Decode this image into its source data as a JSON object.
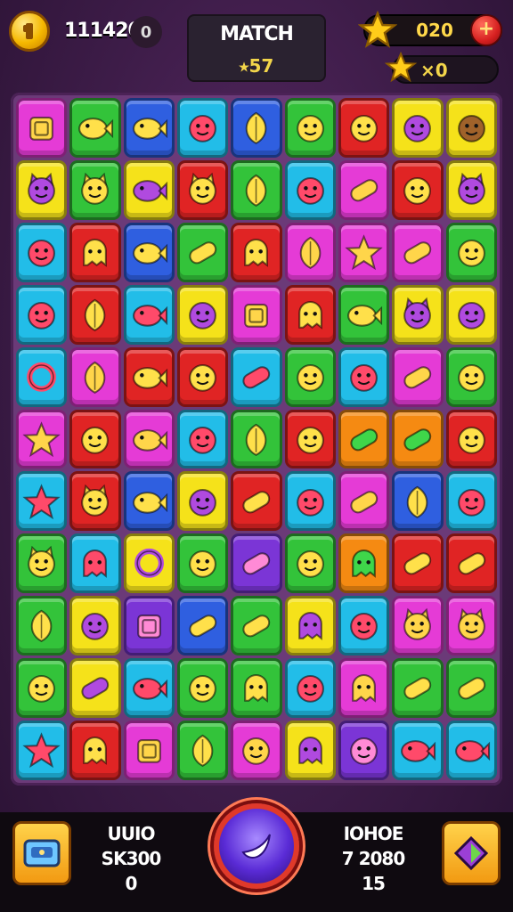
{
  "hud": {
    "coins": "111420",
    "coin_pill": "0",
    "match_title": "MATCH",
    "match_moves": "⭑57",
    "stars": "020",
    "plus": "+",
    "star_count": "×0"
  },
  "bottom": {
    "left_lines": [
      "UUIO",
      "SK300",
      "0"
    ],
    "right_lines": [
      "IOHOE",
      "7 2080",
      "15"
    ]
  },
  "colors": {
    "magenta": "#e53bd6",
    "green": "#33c33a",
    "blue": "#2f5fe0",
    "cyan": "#22bde8",
    "red": "#e02424",
    "yellow": "#f5e21a",
    "purple": "#7b35d6",
    "orange": "#f58a12"
  },
  "tiles": [
    [
      "magenta",
      "cup-icon"
    ],
    [
      "green",
      "fish-face-icon"
    ],
    [
      "blue",
      "fish-face-icon"
    ],
    [
      "cyan",
      "smiley-face-icon"
    ],
    [
      "blue",
      "leaf-icon"
    ],
    [
      "green",
      "smiley-face-icon"
    ],
    [
      "red",
      "smiley-face-icon"
    ],
    [
      "yellow",
      "smiley-face-icon"
    ],
    [
      "yellow",
      "cookie-face-icon"
    ],
    [
      "yellow",
      "cat-face-icon"
    ],
    [
      "green",
      "cat-face-icon"
    ],
    [
      "yellow",
      "fish-face-icon"
    ],
    [
      "red",
      "cat-face-icon"
    ],
    [
      "green",
      "leaf-icon"
    ],
    [
      "cyan",
      "smiley-face-icon"
    ],
    [
      "magenta",
      "bean-icon"
    ],
    [
      "red",
      "smiley-face-icon"
    ],
    [
      "yellow",
      "cat-face-icon"
    ],
    [
      "cyan",
      "smiley-face-icon"
    ],
    [
      "red",
      "ghost-icon"
    ],
    [
      "blue",
      "fish-face-icon"
    ],
    [
      "green",
      "bean-icon"
    ],
    [
      "red",
      "ghost-icon"
    ],
    [
      "magenta",
      "leaf-icon"
    ],
    [
      "magenta",
      "star-icon"
    ],
    [
      "magenta",
      "bean-icon"
    ],
    [
      "green",
      "smiley-face-icon"
    ],
    [
      "cyan",
      "smiley-face-icon"
    ],
    [
      "red",
      "leaf-icon"
    ],
    [
      "cyan",
      "fish-face-icon"
    ],
    [
      "yellow",
      "smiley-face-icon"
    ],
    [
      "magenta",
      "cup-icon"
    ],
    [
      "red",
      "ghost-icon"
    ],
    [
      "green",
      "fish-face-icon"
    ],
    [
      "yellow",
      "cat-face-icon"
    ],
    [
      "yellow",
      "smiley-face-icon"
    ],
    [
      "cyan",
      "ring-icon"
    ],
    [
      "magenta",
      "leaf-icon"
    ],
    [
      "red",
      "fish-face-icon"
    ],
    [
      "red",
      "smiley-face-icon"
    ],
    [
      "cyan",
      "bean-icon"
    ],
    [
      "green",
      "smiley-face-icon"
    ],
    [
      "cyan",
      "smiley-face-icon"
    ],
    [
      "magenta",
      "bean-icon"
    ],
    [
      "green",
      "smiley-face-icon"
    ],
    [
      "magenta",
      "star-icon"
    ],
    [
      "red",
      "smiley-face-icon"
    ],
    [
      "magenta",
      "fish-face-icon"
    ],
    [
      "cyan",
      "smiley-face-icon"
    ],
    [
      "green",
      "leaf-icon"
    ],
    [
      "red",
      "smiley-face-icon"
    ],
    [
      "orange",
      "bean-icon"
    ],
    [
      "orange",
      "bean-icon"
    ],
    [
      "red",
      "smiley-face-icon"
    ],
    [
      "cyan",
      "star-icon"
    ],
    [
      "red",
      "cat-face-icon"
    ],
    [
      "blue",
      "fish-face-icon"
    ],
    [
      "yellow",
      "smiley-face-icon"
    ],
    [
      "red",
      "bean-icon"
    ],
    [
      "cyan",
      "smiley-face-icon"
    ],
    [
      "magenta",
      "bean-icon"
    ],
    [
      "blue",
      "leaf-icon"
    ],
    [
      "cyan",
      "smiley-face-icon"
    ],
    [
      "green",
      "cat-face-icon"
    ],
    [
      "cyan",
      "ghost-icon"
    ],
    [
      "yellow",
      "ring-icon"
    ],
    [
      "green",
      "smiley-face-icon"
    ],
    [
      "purple",
      "bean-icon"
    ],
    [
      "green",
      "smiley-face-icon"
    ],
    [
      "orange",
      "ghost-icon"
    ],
    [
      "red",
      "bean-icon"
    ],
    [
      "red",
      "bean-icon"
    ],
    [
      "green",
      "leaf-icon"
    ],
    [
      "yellow",
      "smiley-face-icon"
    ],
    [
      "purple",
      "cup-icon"
    ],
    [
      "blue",
      "bean-icon"
    ],
    [
      "green",
      "bean-icon"
    ],
    [
      "yellow",
      "ghost-icon"
    ],
    [
      "cyan",
      "smiley-face-icon"
    ],
    [
      "magenta",
      "cat-face-icon"
    ],
    [
      "magenta",
      "cat-face-icon"
    ],
    [
      "green",
      "smiley-face-icon"
    ],
    [
      "yellow",
      "bean-icon"
    ],
    [
      "cyan",
      "fish-face-icon"
    ],
    [
      "green",
      "smiley-face-icon"
    ],
    [
      "green",
      "ghost-icon"
    ],
    [
      "cyan",
      "smiley-face-icon"
    ],
    [
      "magenta",
      "ghost-icon"
    ],
    [
      "green",
      "bean-icon"
    ],
    [
      "green",
      "bean-icon"
    ],
    [
      "cyan",
      "star-icon"
    ],
    [
      "red",
      "ghost-icon"
    ],
    [
      "magenta",
      "cup-icon"
    ],
    [
      "green",
      "leaf-icon"
    ],
    [
      "magenta",
      "smiley-face-icon"
    ],
    [
      "yellow",
      "ghost-icon"
    ],
    [
      "purple",
      "smiley-face-icon"
    ],
    [
      "cyan",
      "fish-face-icon"
    ],
    [
      "cyan",
      "fish-face-icon"
    ]
  ]
}
